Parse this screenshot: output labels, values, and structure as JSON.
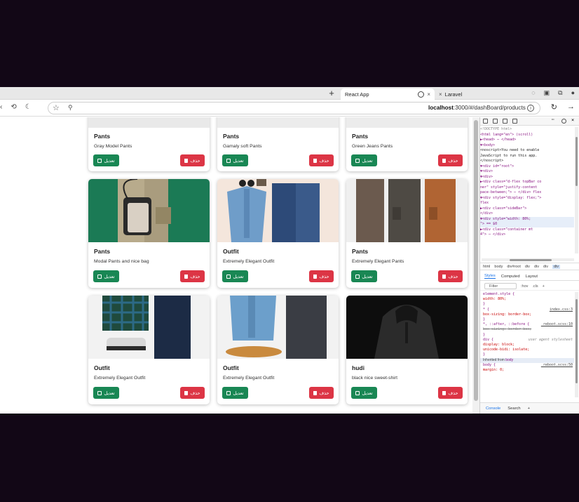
{
  "browser": {
    "new_tab": "+",
    "tabs": [
      {
        "label": "React App",
        "close": "×"
      },
      {
        "label": "Laravel",
        "close": "×"
      }
    ],
    "url_host": "localhost",
    "url_path": ":3000/#/dashBoard/products"
  },
  "colors": {
    "edit_button": "#198754",
    "delete_button": "#dc3545"
  },
  "products": [
    {
      "title": "Pants",
      "description": "Gray Model Pants",
      "edit_label": "تعديل",
      "delete_label": "حذف",
      "image": "gray-pants"
    },
    {
      "title": "Pants",
      "description": "Gamaly soft Pants",
      "edit_label": "تعديل",
      "delete_label": "حذف",
      "image": "brown-pants"
    },
    {
      "title": "Pants",
      "description": "Green Jeans Pants",
      "edit_label": "تعديل",
      "delete_label": "حذف",
      "image": "green-pants"
    },
    {
      "title": "Pants",
      "description": "Modal Pants and nice bag",
      "edit_label": "تعديل",
      "delete_label": "حذف",
      "image": "pants-with-bag"
    },
    {
      "title": "Outfit",
      "description": "Extremely Elegant Outfit",
      "edit_label": "تعديل",
      "delete_label": "حذف",
      "image": "denim-outfit"
    },
    {
      "title": "Pants",
      "description": "Extremely Elegant Pants",
      "edit_label": "تعديل",
      "delete_label": "حذف",
      "image": "cargo-pants-trio"
    },
    {
      "title": "Outfit",
      "description": "Extremely Elegant Outfit",
      "edit_label": "تعديل",
      "delete_label": "حذف",
      "image": "plaid-outfit"
    },
    {
      "title": "Outfit",
      "description": "Extremely Elegant Outfit",
      "edit_label": "تعديل",
      "delete_label": "حذف",
      "image": "denim-shirt-outfit"
    },
    {
      "title": "hudi",
      "description": "black nice sweet-shirt",
      "edit_label": "تعديل",
      "delete_label": "حذف",
      "image": "black-hoodie"
    }
  ],
  "devtools": {
    "dom_lines": [
      "<!DOCTYPE html>",
      "<html lang=\"en\"> (scroll)",
      "▶<head> ⋯ </head>",
      "▼<body>",
      "  <noscript>You need to enable",
      "  JavaScript to run this app.",
      "  </noscript>",
      " ▼<div id=\"root\">",
      "  ▼<div>",
      "   ▼<div>",
      "    ▶<div class=\"d-flex topBar co",
      "    ner\" style=\"justify-content",
      "    pace-between;\"> ⋯ </div> flex",
      "   ▼<div style=\"display: flex;\">",
      "     flex",
      "    ▶<div class=\"sideBar\">",
      "    </div>",
      "   ▼<div style=\"width: 80%;",
      "    \"> == $0",
      "     ▶<div class=\"container mt",
      "     4\"> ⋯ </div>"
    ],
    "breadcrumbs": [
      "html",
      "body",
      "div#root",
      "div",
      "div",
      "div",
      "div"
    ],
    "panel_tabs": [
      "Styles",
      "Computed",
      "Layout"
    ],
    "filter_placeholder": "Filter",
    "filter_tools": [
      ":hov",
      ".cls",
      "+"
    ],
    "style_lines": [
      {
        "text": "element.style {",
        "source": ""
      },
      {
        "text": "  width: 80%;",
        "source": ""
      },
      {
        "text": "}",
        "source": ""
      },
      {
        "text": "* {",
        "source": "index.css:3"
      },
      {
        "text": "  box-sizing: border-box;",
        "source": ""
      },
      {
        "text": "}",
        "source": ""
      },
      {
        "text": "*, ::after, ::before {",
        "source": "_reboot.scss:10"
      },
      {
        "text": "  box-sizing: border-box;",
        "source": ""
      },
      {
        "text": "}",
        "source": ""
      },
      {
        "text": "div {",
        "source": "user agent stylesheet"
      },
      {
        "text": "  display: block;",
        "source": ""
      },
      {
        "text": "  unicode-bidi: isolate;",
        "source": ""
      },
      {
        "text": "}",
        "source": ""
      }
    ],
    "inherited_label": "Inherited from",
    "inherited_from": "body",
    "body_rule": "body {",
    "body_source": "_reboot.scss:50",
    "body_line": "  margin: 0;",
    "drawer_tabs": [
      "Console",
      "Search"
    ]
  }
}
